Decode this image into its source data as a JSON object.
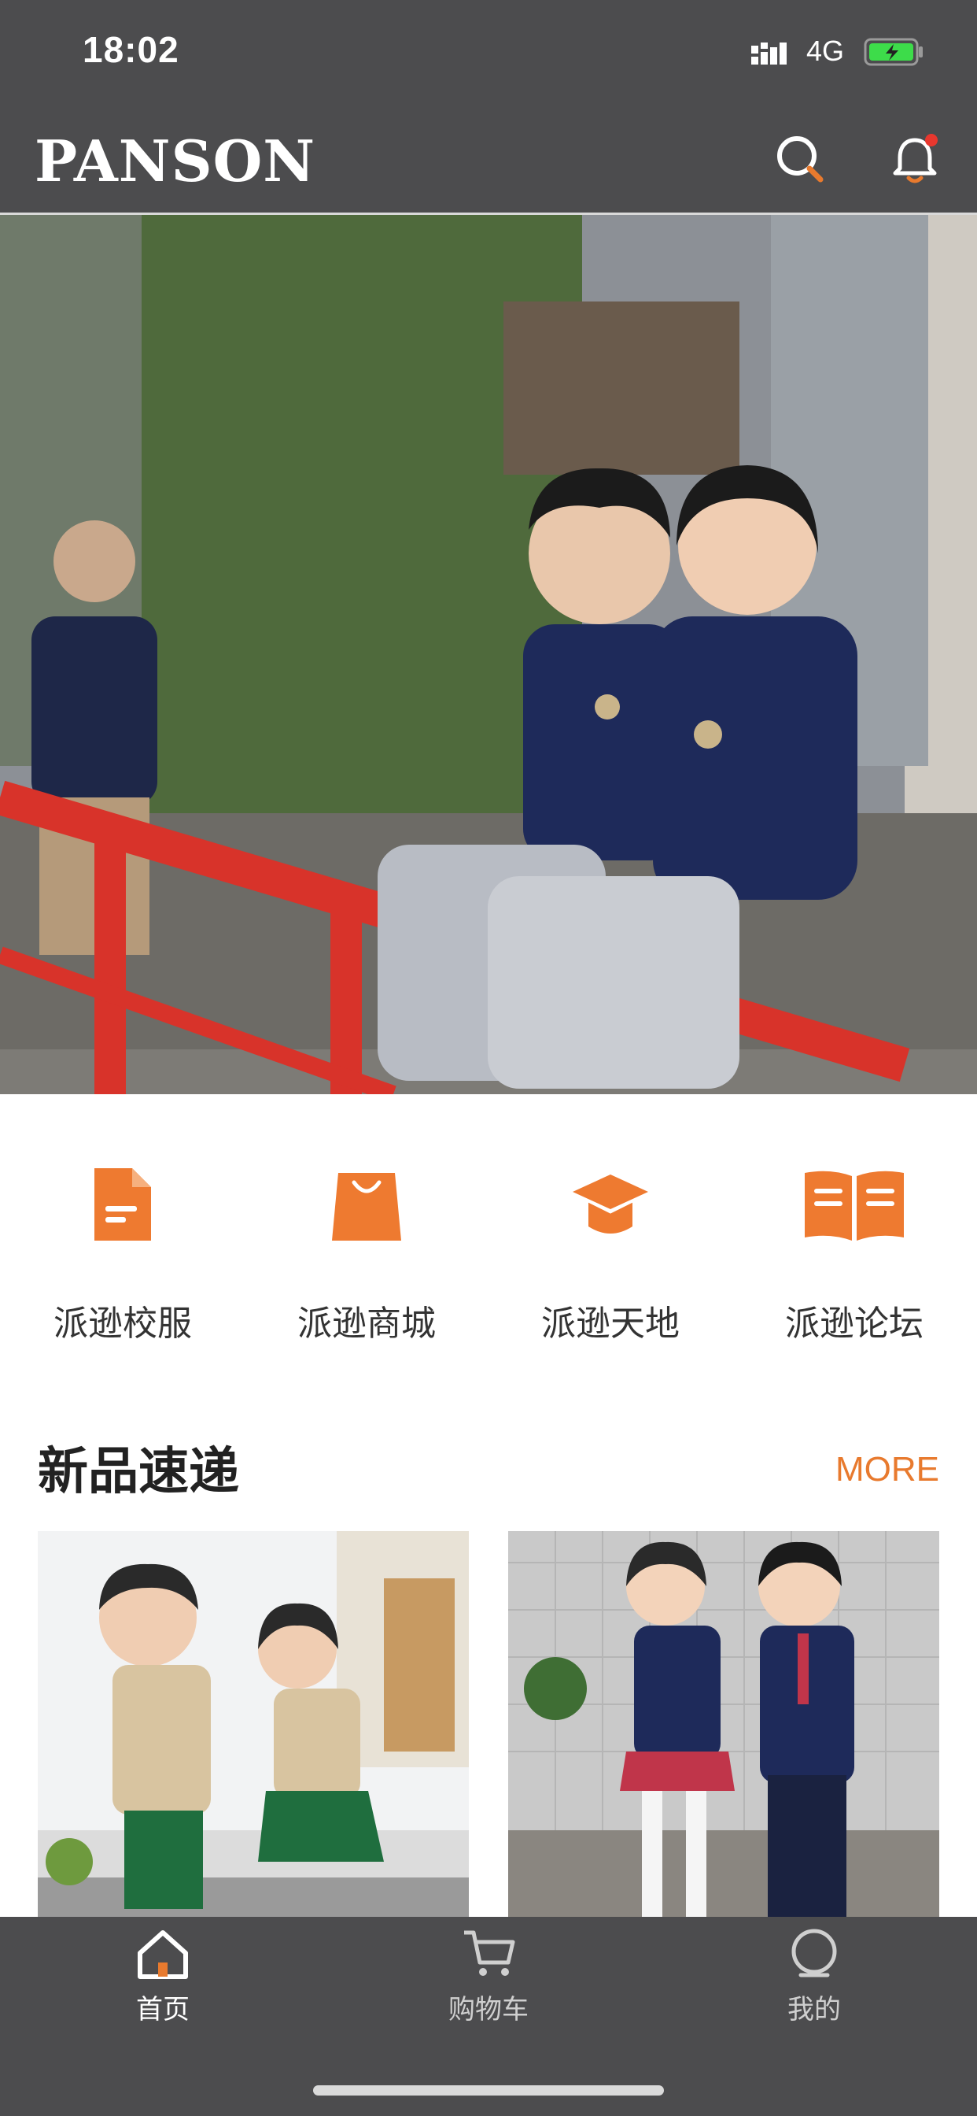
{
  "status_bar": {
    "time": "18:02",
    "network": "4G"
  },
  "header": {
    "logo": "PANSON"
  },
  "categories": [
    {
      "label": "派逊校服",
      "icon": "document-icon"
    },
    {
      "label": "派逊商城",
      "icon": "shopping-bag-icon"
    },
    {
      "label": "派逊天地",
      "icon": "graduation-cap-icon"
    },
    {
      "label": "派逊论坛",
      "icon": "open-book-icon"
    }
  ],
  "new_arrivals": {
    "title": "新品速递",
    "more": "MORE"
  },
  "tab_bar": [
    {
      "label": "首页",
      "icon": "home-icon",
      "active": true
    },
    {
      "label": "购物车",
      "icon": "cart-icon",
      "active": false
    },
    {
      "label": "我的",
      "icon": "profile-icon",
      "active": false
    }
  ],
  "colors": {
    "accent": "#e87a2e",
    "bar": "#4c4c4e"
  }
}
